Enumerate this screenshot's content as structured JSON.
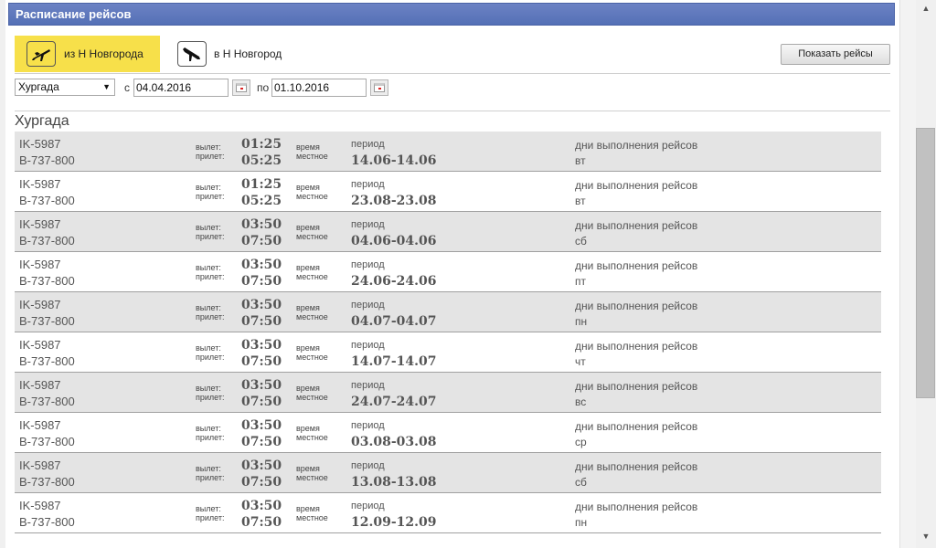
{
  "header": {
    "title": "Расписание рейсов"
  },
  "tabs": {
    "from": {
      "label": "из Н Новгорода",
      "icon": "plane-departure-icon",
      "active": true
    },
    "to": {
      "label": "в Н Новгород",
      "icon": "plane-arrival-icon",
      "active": false
    }
  },
  "show_button": "Показать рейсы",
  "filters": {
    "destination": "Хургада",
    "from_label": "с",
    "from_date": "04.04.2016",
    "to_label": "по",
    "to_date": "01.10.2016"
  },
  "city_title": "Хургада",
  "labels": {
    "departure": "вылет:",
    "arrival": "прилет:",
    "time1": "время",
    "time2": "местное",
    "period": "период",
    "days": "дни выполнения рейсов"
  },
  "flights": [
    {
      "flight": "IK-5987",
      "aircraft": "B-737-800",
      "dep": "01:25",
      "arr": "05:25",
      "period": "14.06-14.06",
      "days": "вт"
    },
    {
      "flight": "IK-5987",
      "aircraft": "B-737-800",
      "dep": "01:25",
      "arr": "05:25",
      "period": "23.08-23.08",
      "days": "вт"
    },
    {
      "flight": "IK-5987",
      "aircraft": "B-737-800",
      "dep": "03:50",
      "arr": "07:50",
      "period": "04.06-04.06",
      "days": "сб"
    },
    {
      "flight": "IK-5987",
      "aircraft": "B-737-800",
      "dep": "03:50",
      "arr": "07:50",
      "period": "24.06-24.06",
      "days": "пт"
    },
    {
      "flight": "IK-5987",
      "aircraft": "B-737-800",
      "dep": "03:50",
      "arr": "07:50",
      "period": "04.07-04.07",
      "days": "пн"
    },
    {
      "flight": "IK-5987",
      "aircraft": "B-737-800",
      "dep": "03:50",
      "arr": "07:50",
      "period": "14.07-14.07",
      "days": "чт"
    },
    {
      "flight": "IK-5987",
      "aircraft": "B-737-800",
      "dep": "03:50",
      "arr": "07:50",
      "period": "24.07-24.07",
      "days": "вс"
    },
    {
      "flight": "IK-5987",
      "aircraft": "B-737-800",
      "dep": "03:50",
      "arr": "07:50",
      "period": "03.08-03.08",
      "days": "ср"
    },
    {
      "flight": "IK-5987",
      "aircraft": "B-737-800",
      "dep": "03:50",
      "arr": "07:50",
      "period": "13.08-13.08",
      "days": "сб"
    },
    {
      "flight": "IK-5987",
      "aircraft": "B-737-800",
      "dep": "03:50",
      "arr": "07:50",
      "period": "12.09-12.09",
      "days": "пн"
    }
  ]
}
